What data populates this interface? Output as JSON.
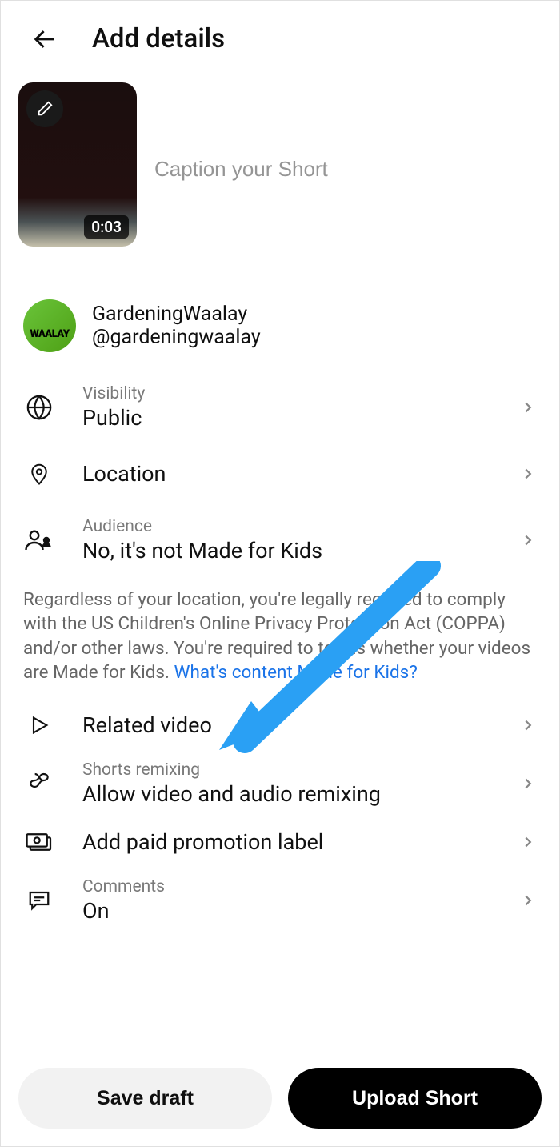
{
  "header": {
    "title": "Add details"
  },
  "thumb": {
    "duration": "0:03"
  },
  "caption": {
    "placeholder": "Caption your Short"
  },
  "channel": {
    "name": "GardeningWaalay",
    "handle": "@gardeningwaalay",
    "avatar_text": "WAALAY"
  },
  "rows": {
    "visibility": {
      "label": "Visibility",
      "value": "Public"
    },
    "location": {
      "value": "Location"
    },
    "audience": {
      "label": "Audience",
      "value": "No, it's not Made for Kids"
    },
    "related": {
      "value": "Related video"
    },
    "remix": {
      "label": "Shorts remixing",
      "value": "Allow video and audio remixing"
    },
    "promo": {
      "value": "Add paid promotion label"
    },
    "comments": {
      "label": "Comments",
      "value": "On"
    }
  },
  "coppa": {
    "text": "Regardless of your location, you're legally required to comply with the US Children's Online Privacy Protection Act (COPPA) and/or other laws. You're required to tell us whether your videos are Made for Kids. ",
    "link": "What's content Made for Kids?"
  },
  "buttons": {
    "save": "Save draft",
    "upload": "Upload Short"
  }
}
